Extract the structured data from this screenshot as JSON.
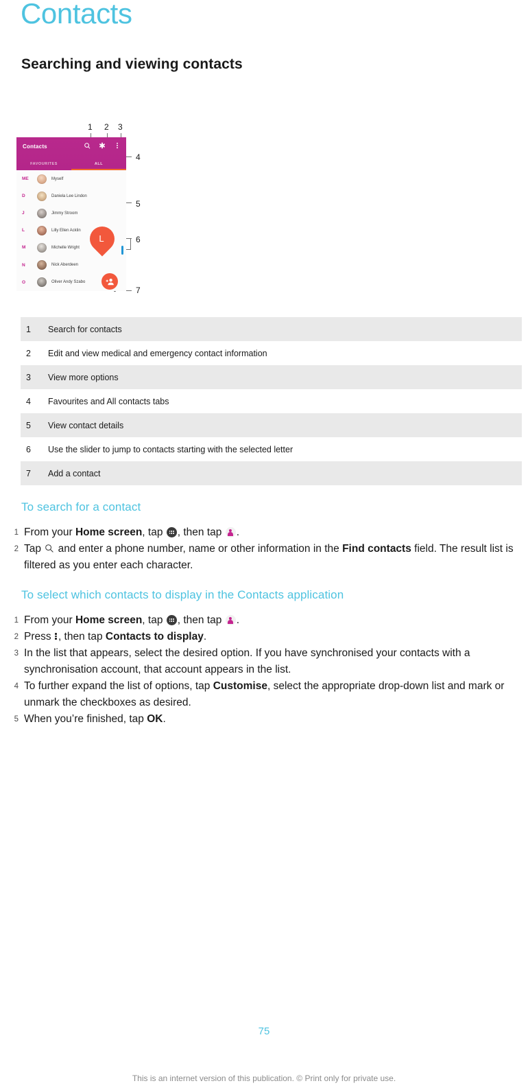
{
  "document": {
    "chapter_title": "Contacts",
    "section_title": "Searching and viewing contacts",
    "page_number": "75",
    "footer_note": "This is an internet version of this publication. © Print only for private use."
  },
  "figure": {
    "callout_numbers": [
      "1",
      "2",
      "3",
      "4",
      "5",
      "6",
      "7"
    ],
    "phone": {
      "appbar_title": "Contacts",
      "appbar_icons": [
        {
          "name": "search-icon",
          "callout": "1"
        },
        {
          "name": "medical-info-asterisk-icon",
          "callout": "2"
        },
        {
          "name": "overflow-menu-icon",
          "callout": "3"
        }
      ],
      "tabs": [
        {
          "label": "FAVOURITES",
          "active": false
        },
        {
          "label": "ALL",
          "active": true
        }
      ],
      "contacts": [
        {
          "letter": "ME",
          "name": "Myself"
        },
        {
          "letter": "D",
          "name": "Daniela Lee Lindon"
        },
        {
          "letter": "J",
          "name": "Jimmy Stroom"
        },
        {
          "letter": "L",
          "name": "Lilly Ellen Acklin"
        },
        {
          "letter": "M",
          "name": "Michelle Wright"
        },
        {
          "letter": "N",
          "name": "Nick Aberdeen"
        },
        {
          "letter": "O",
          "name": "Oliver Andy Szabo"
        }
      ],
      "slider_letter": "L",
      "fab_label": "add-contact"
    },
    "colors": {
      "appbar": "#b4268a",
      "tab_indicator": "#f2682a",
      "accent_orange": "#f2583c",
      "index_letter": "#c4248f",
      "slider_track": "#2196d6"
    }
  },
  "legend": {
    "rows": [
      {
        "num": "1",
        "text": "Search for contacts"
      },
      {
        "num": "2",
        "text": "Edit and view medical and emergency contact information"
      },
      {
        "num": "3",
        "text": "View more options"
      },
      {
        "num": "4",
        "text": "Favourites and All contacts tabs"
      },
      {
        "num": "5",
        "text": "View contact details"
      },
      {
        "num": "6",
        "text": "Use the slider to jump to contacts starting with the selected letter"
      },
      {
        "num": "7",
        "text": "Add a contact"
      }
    ]
  },
  "procedures": [
    {
      "title": "To search for a contact",
      "steps": [
        {
          "num": "1",
          "parts": [
            {
              "t": "From your "
            },
            {
              "t": "Home screen",
              "b": true
            },
            {
              "t": ", tap "
            },
            {
              "icon": "apps-icon"
            },
            {
              "t": ", then tap "
            },
            {
              "icon": "contacts-icon"
            },
            {
              "t": "."
            }
          ]
        },
        {
          "num": "2",
          "parts": [
            {
              "t": "Tap "
            },
            {
              "icon": "search-icon"
            },
            {
              "t": " and enter a phone number, name or other information in the "
            },
            {
              "t": "Find contacts",
              "b": true
            },
            {
              "t": " field. The result list is filtered as you enter each character."
            }
          ]
        }
      ]
    },
    {
      "title": "To select which contacts to display in the Contacts application",
      "steps": [
        {
          "num": "1",
          "parts": [
            {
              "t": "From your "
            },
            {
              "t": "Home screen",
              "b": true
            },
            {
              "t": ", tap "
            },
            {
              "icon": "apps-icon"
            },
            {
              "t": ", then tap "
            },
            {
              "icon": "contacts-icon"
            },
            {
              "t": "."
            }
          ]
        },
        {
          "num": "2",
          "parts": [
            {
              "t": "Press "
            },
            {
              "icon": "overflow-menu-icon"
            },
            {
              "t": ", then tap "
            },
            {
              "t": "Contacts to display",
              "b": true
            },
            {
              "t": "."
            }
          ]
        },
        {
          "num": "3",
          "parts": [
            {
              "t": "In the list that appears, select the desired option. If you have synchronised your contacts with a synchronisation account, that account appears in the list."
            }
          ]
        },
        {
          "num": "4",
          "parts": [
            {
              "t": "To further expand the list of options, tap "
            },
            {
              "t": "Customise",
              "b": true
            },
            {
              "t": ", select the appropriate drop-down list and mark or unmark the checkboxes as desired."
            }
          ]
        },
        {
          "num": "5",
          "parts": [
            {
              "t": "When you’re finished, tap "
            },
            {
              "t": "OK",
              "b": true
            },
            {
              "t": "."
            }
          ]
        }
      ]
    }
  ]
}
